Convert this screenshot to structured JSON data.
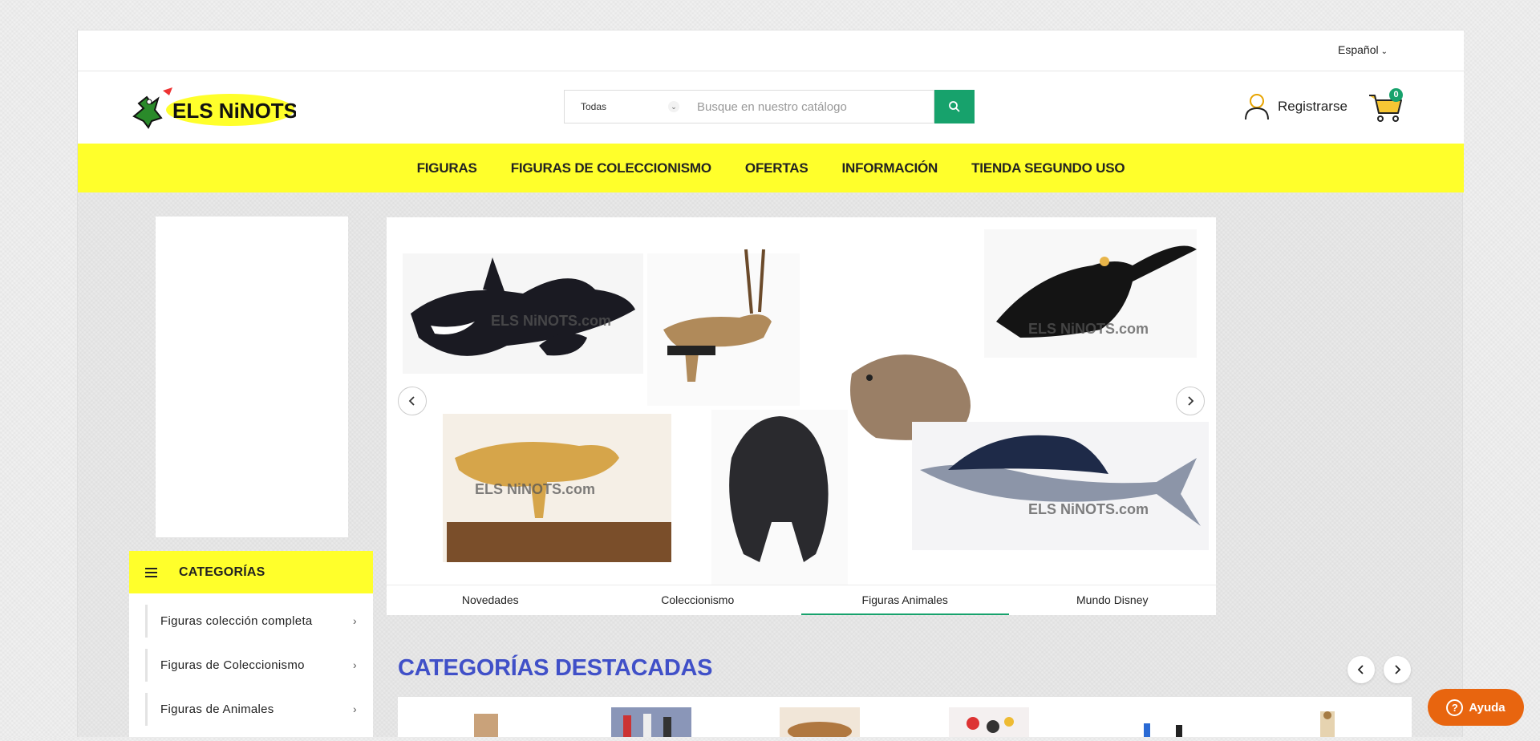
{
  "topbar": {
    "language": "Español"
  },
  "header": {
    "logo_text": "ELS NiNOTS",
    "search": {
      "category_selected": "Todas",
      "placeholder": "Busque en nuestro catálogo"
    },
    "account_label": "Registrarse",
    "cart_count": "0"
  },
  "nav": {
    "items": [
      "FIGURAS",
      "FIGURAS DE COLECCIONISMO",
      "OFERTAS",
      "INFORMACIÓN",
      "TIENDA SEGUNDO USO"
    ]
  },
  "categories": {
    "title": "CATEGORÍAS",
    "items": [
      "Figuras colección completa",
      "Figuras de Coleccionismo",
      "Figuras de Animales"
    ]
  },
  "slider": {
    "watermark": "ELS NiNOTS.com",
    "tabs": [
      "Novedades",
      "Coleccionismo",
      "Figuras Animales",
      "Mundo Disney"
    ],
    "active_tab": "Figuras Animales"
  },
  "featured": {
    "title": "CATEGORÍAS DESTACADAS"
  },
  "help": {
    "label": "Ayuda"
  },
  "colors": {
    "accent_green": "#17a26c",
    "nav_yellow": "#ffff2b",
    "featured_blue": "#4050c8",
    "help_orange": "#e8650f"
  }
}
